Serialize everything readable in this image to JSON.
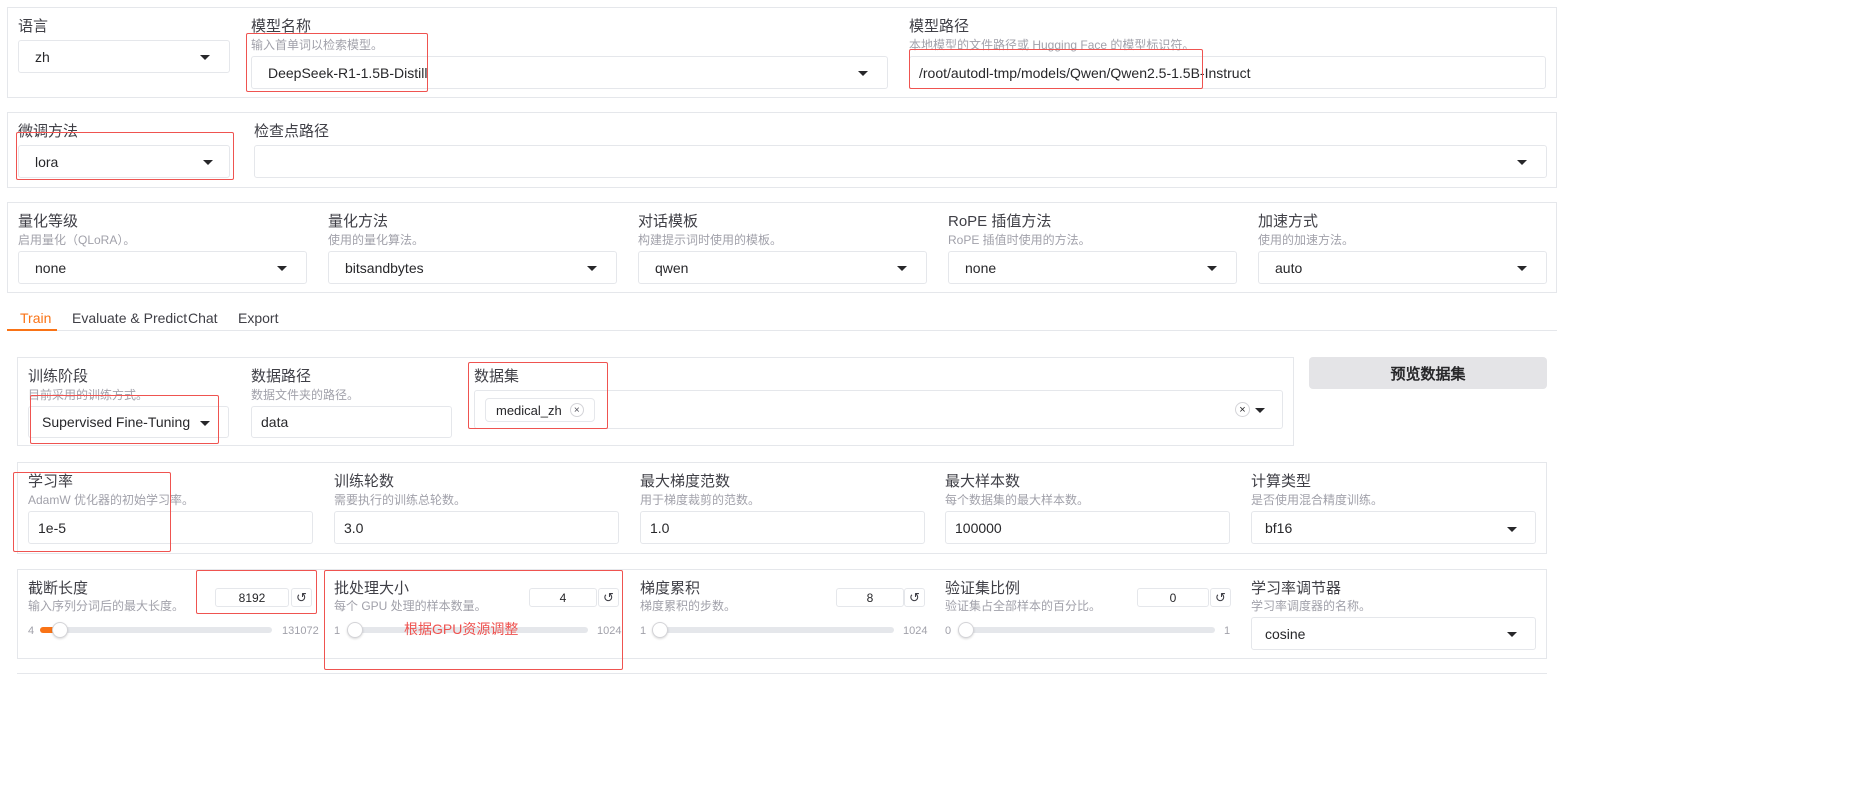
{
  "colors": {
    "accent": "#f97316",
    "annotation": "#ef5350",
    "border": "#e5e7eb"
  },
  "top": {
    "lang": {
      "label": "语言",
      "value": "zh"
    },
    "model_name": {
      "label": "模型名称",
      "info": "输入首单词以检索模型。",
      "value": "DeepSeek-R1-1.5B-Distill"
    },
    "model_path": {
      "label": "模型路径",
      "info": "本地模型的文件路径或 Hugging Face 的模型标识符。",
      "value": "/root/autodl-tmp/models/Qwen/Qwen2.5-1.5B-Instruct"
    },
    "finetune": {
      "label": "微调方法",
      "value": "lora"
    },
    "checkpoint": {
      "label": "检查点路径",
      "value": ""
    },
    "quant_bit": {
      "label": "量化等级",
      "info": "启用量化（QLoRA）。",
      "value": "none"
    },
    "quant_method": {
      "label": "量化方法",
      "info": "使用的量化算法。",
      "value": "bitsandbytes"
    },
    "template": {
      "label": "对话模板",
      "info": "构建提示词时使用的模板。",
      "value": "qwen"
    },
    "rope": {
      "label": "RoPE 插值方法",
      "info": "RoPE 插值时使用的方法。",
      "value": "none"
    },
    "booster": {
      "label": "加速方式",
      "info": "使用的加速方法。",
      "value": "auto"
    }
  },
  "tabs": [
    "Train",
    "Evaluate & Predict",
    "Chat",
    "Export"
  ],
  "train": {
    "stage": {
      "label": "训练阶段",
      "info": "目前采用的训练方式。",
      "value": "Supervised Fine-Tuning"
    },
    "dataset_dir": {
      "label": "数据路径",
      "info": "数据文件夹的路径。",
      "value": "data"
    },
    "dataset": {
      "label": "数据集",
      "tag": "medical_zh",
      "tag_remove": "×",
      "clear": "×"
    },
    "preview_button": "预览数据集",
    "lr": {
      "label": "学习率",
      "info": "AdamW 优化器的初始学习率。",
      "value": "1e-5"
    },
    "epochs": {
      "label": "训练轮数",
      "info": "需要执行的训练总轮数。",
      "value": "3.0"
    },
    "max_grad_norm": {
      "label": "最大梯度范数",
      "info": "用于梯度裁剪的范数。",
      "value": "1.0"
    },
    "max_samples": {
      "label": "最大样本数",
      "info": "每个数据集的最大样本数。",
      "value": "100000"
    },
    "compute_type": {
      "label": "计算类型",
      "info": "是否使用混合精度训练。",
      "value": "bf16"
    },
    "cutoff_len": {
      "label": "截断长度",
      "info": "输入序列分词后的最大长度。",
      "value": "8192",
      "min": "4",
      "max": "131072",
      "fraction": 0.062
    },
    "batch_size": {
      "label": "批处理大小",
      "info": "每个 GPU 处理的样本数量。",
      "value": "4",
      "min": "1",
      "max": "1024",
      "fraction": 0.003
    },
    "grad_accum": {
      "label": "梯度累积",
      "info": "梯度累积的步数。",
      "value": "8",
      "min": "1",
      "max": "1024",
      "fraction": 0.007
    },
    "val_size": {
      "label": "验证集比例",
      "info": "验证集占全部样本的百分比。",
      "value": "0",
      "min": "0",
      "max": "1",
      "fraction": 0
    },
    "lr_scheduler": {
      "label": "学习率调节器",
      "info": "学习率调度器的名称。",
      "value": "cosine"
    },
    "reset_icon": "↺"
  },
  "annotation": "根据GPU资源调整"
}
